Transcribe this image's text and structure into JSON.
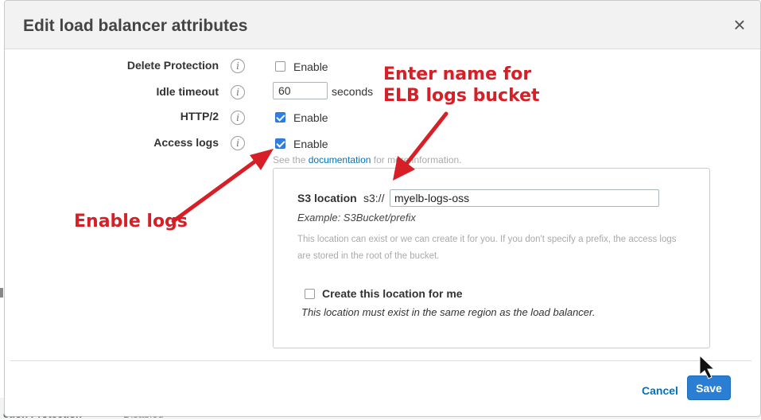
{
  "background": {
    "left_label": "ction Protection",
    "right_label": "Disabled"
  },
  "dialog": {
    "title": "Edit load balancer attributes",
    "close_icon": "×"
  },
  "rows": {
    "delete_protection": {
      "label": "Delete Protection",
      "option": "Enable",
      "checked": false
    },
    "idle_timeout": {
      "label": "Idle timeout",
      "value": "60",
      "unit": "seconds"
    },
    "http2": {
      "label": "HTTP/2",
      "option": "Enable",
      "checked": true
    },
    "access_logs": {
      "label": "Access logs",
      "option": "Enable",
      "checked": true
    }
  },
  "info_icon": "i",
  "see_doc": {
    "prefix": "See the",
    "link": "documentation",
    "suffix": "for more information."
  },
  "s3": {
    "label": "S3 location",
    "prefix": "s3://",
    "value": "myelb-logs-oss",
    "example": "Example: S3Bucket/prefix",
    "hint": "This location can exist or we can create it for you. If you don't specify a prefix, the access logs are stored in the root of the bucket.",
    "create_label": "Create this location for me",
    "create_checked": false,
    "region_note": "This location must exist in the same region as the load balancer."
  },
  "footer": {
    "cancel_label": "Cancel",
    "save_label": "Save"
  },
  "annotations": {
    "bucket_line1": "Enter name for",
    "bucket_line2": "ELB logs bucket",
    "enable_logs": "Enable logs"
  },
  "colors": {
    "accent_blue": "#2a7ed3",
    "link_blue": "#0073bb",
    "annotation_red": "#d61f26"
  }
}
